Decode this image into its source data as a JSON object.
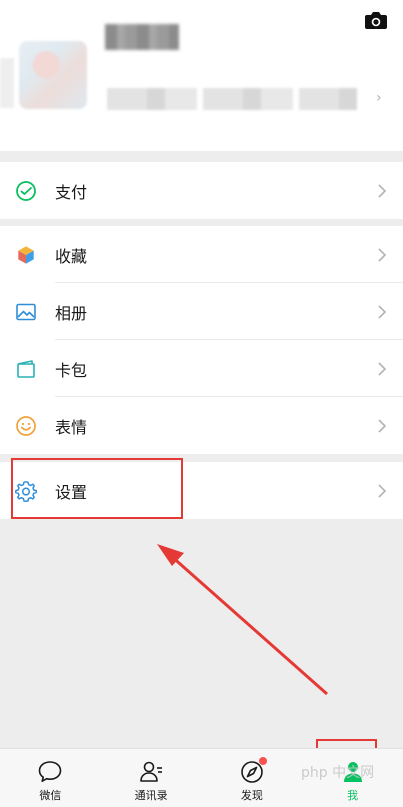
{
  "profile": {
    "camera_icon": "camera-icon"
  },
  "menu": {
    "pay": "支付",
    "favorites": "收藏",
    "album": "相册",
    "cards": "卡包",
    "stickers": "表情",
    "settings": "设置"
  },
  "tabbar": {
    "chats": "微信",
    "contacts": "通讯录",
    "discover": "发现",
    "me": "我"
  },
  "watermark": "php 中文网",
  "colors": {
    "accent": "#07c160",
    "annotation": "#e53935",
    "badge": "#fa5151"
  }
}
